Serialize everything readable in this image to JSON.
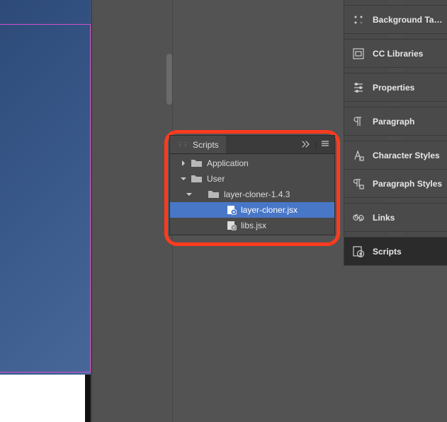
{
  "scripts_panel": {
    "title": "Scripts",
    "tree": {
      "application": {
        "label": "Application"
      },
      "user": {
        "label": "User"
      },
      "folder": {
        "label": "layer-cloner-1.4.3"
      },
      "file1": {
        "label": "layer-cloner.jsx"
      },
      "file2": {
        "label": "libs.jsx"
      }
    }
  },
  "right_panels": {
    "bg_tasks": "Background Tas…",
    "cc_libraries": "CC Libraries",
    "properties": "Properties",
    "paragraph": "Paragraph",
    "char_styles": "Character Styles",
    "para_styles": "Paragraph Styles",
    "links": "Links",
    "scripts": "Scripts"
  }
}
